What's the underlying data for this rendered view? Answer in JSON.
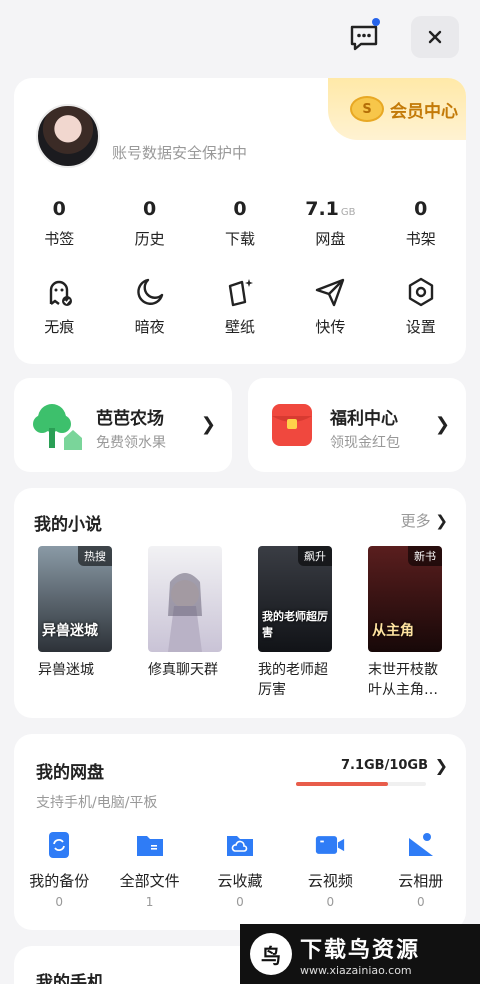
{
  "colors": {
    "accent": "#e85c4a",
    "vip_gold": "#c37a08",
    "link_blue": "#2563eb"
  },
  "topbar": {
    "message_icon": "message-icon",
    "close_icon": "close-icon"
  },
  "profile": {
    "vip_label": "会员中心",
    "vip_coin": "S",
    "protect_text": "账号数据安全保护中",
    "stats": [
      {
        "value": "0",
        "unit": "",
        "label": "书签"
      },
      {
        "value": "0",
        "unit": "",
        "label": "历史"
      },
      {
        "value": "0",
        "unit": "",
        "label": "下载"
      },
      {
        "value": "7.1",
        "unit": "GB",
        "label": "网盘"
      },
      {
        "value": "0",
        "unit": "",
        "label": "书架"
      }
    ],
    "tools": [
      {
        "label": "无痕",
        "icon": "ghost-icon"
      },
      {
        "label": "暗夜",
        "icon": "moon-icon"
      },
      {
        "label": "壁纸",
        "icon": "wallpaper-icon"
      },
      {
        "label": "快传",
        "icon": "send-icon"
      },
      {
        "label": "设置",
        "icon": "settings-icon"
      }
    ]
  },
  "farm": {
    "title": "芭芭农场",
    "subtitle": "免费领水果"
  },
  "welfare": {
    "title": "福利中心",
    "subtitle": "领现金红包"
  },
  "novels": {
    "title": "我的小说",
    "more": "更多",
    "books": [
      {
        "name": "异兽迷城",
        "tag": "热搜",
        "cover_text": "异兽迷城"
      },
      {
        "name": "修真聊天群",
        "tag": "",
        "cover_text": ""
      },
      {
        "name": "我的老师超厉害",
        "tag": "飙升",
        "cover_text": "我的老师超厉害"
      },
      {
        "name": "末世开枝散叶从主角…",
        "tag": "新书",
        "cover_text": "从主角"
      }
    ]
  },
  "disk": {
    "title": "我的网盘",
    "subtitle": "支持手机/电脑/平板",
    "usage": "7.1GB/10GB",
    "used_fraction": 0.71,
    "items": [
      {
        "label": "我的备份",
        "count": "0",
        "icon": "backup-icon"
      },
      {
        "label": "全部文件",
        "count": "1",
        "icon": "folder-icon"
      },
      {
        "label": "云收藏",
        "count": "0",
        "icon": "cloud-folder-icon"
      },
      {
        "label": "云视频",
        "count": "0",
        "icon": "video-icon"
      },
      {
        "label": "云相册",
        "count": "0",
        "icon": "album-icon"
      }
    ]
  },
  "phone": {
    "title": "我的手机"
  },
  "watermark": {
    "logo": "鸟",
    "main": "下载鸟资源",
    "url": "www.xiazainiao.com"
  }
}
